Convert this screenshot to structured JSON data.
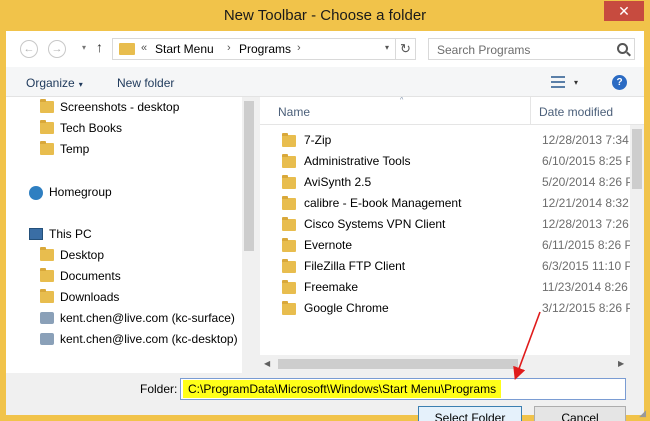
{
  "window": {
    "title": "New Toolbar - Choose a folder",
    "close_glyph": "✕"
  },
  "nav": {
    "back_glyph": "←",
    "forward_glyph": "→",
    "up_glyph": "↑",
    "dropdown_glyph": "▾"
  },
  "address": {
    "overflow": "«",
    "crumbs": [
      "Start Menu",
      "Programs"
    ],
    "separator": "›",
    "refresh_glyph": "↻"
  },
  "search": {
    "placeholder": "Search Programs"
  },
  "toolbar": {
    "organize_label": "Organize",
    "new_folder_label": "New folder",
    "help_glyph": "?"
  },
  "sidebar": {
    "items": [
      {
        "label": "Screenshots - desktop",
        "icon": "folder-icon"
      },
      {
        "label": "Tech Books",
        "icon": "folder-icon"
      },
      {
        "label": "Temp",
        "icon": "folder-icon"
      },
      {
        "label": "Homegroup",
        "icon": "homegroup-icon"
      },
      {
        "label": "This PC",
        "icon": "computer-icon"
      },
      {
        "label": "Desktop",
        "icon": "folder-icon"
      },
      {
        "label": "Documents",
        "icon": "folder-icon"
      },
      {
        "label": "Downloads",
        "icon": "folder-icon"
      },
      {
        "label": "kent.chen@live.com (kc-surface)",
        "icon": "user-icon"
      },
      {
        "label": "kent.chen@live.com (kc-desktop)",
        "icon": "user-icon"
      }
    ]
  },
  "files": {
    "columns": {
      "name": "Name",
      "date": "Date modified",
      "sort_glyph": "^"
    },
    "rows": [
      {
        "name": "7-Zip",
        "date": "12/28/2013 7:34"
      },
      {
        "name": "Administrative Tools",
        "date": "6/10/2015 8:25 P"
      },
      {
        "name": "AviSynth 2.5",
        "date": "5/20/2014 8:26 P"
      },
      {
        "name": "calibre - E-book Management",
        "date": "12/21/2014 8:32"
      },
      {
        "name": "Cisco Systems VPN Client",
        "date": "12/28/2013 7:26"
      },
      {
        "name": "Evernote",
        "date": "6/11/2015 8:26 P"
      },
      {
        "name": "FileZilla FTP Client",
        "date": "6/3/2015 11:10 P"
      },
      {
        "name": "Freemake",
        "date": "11/23/2014 8:26"
      },
      {
        "name": "Google Chrome",
        "date": "3/12/2015 8:26 P"
      }
    ]
  },
  "footer": {
    "folder_label": "Folder:",
    "folder_value": "C:\\ProgramData\\Microsoft\\Windows\\Start Menu\\Programs",
    "select_label": "Select Folder",
    "cancel_label": "Cancel"
  },
  "colors": {
    "title_bar": "#f1c34a",
    "highlight": "#ffff19",
    "annotation_arrow": "#e01b1b"
  }
}
